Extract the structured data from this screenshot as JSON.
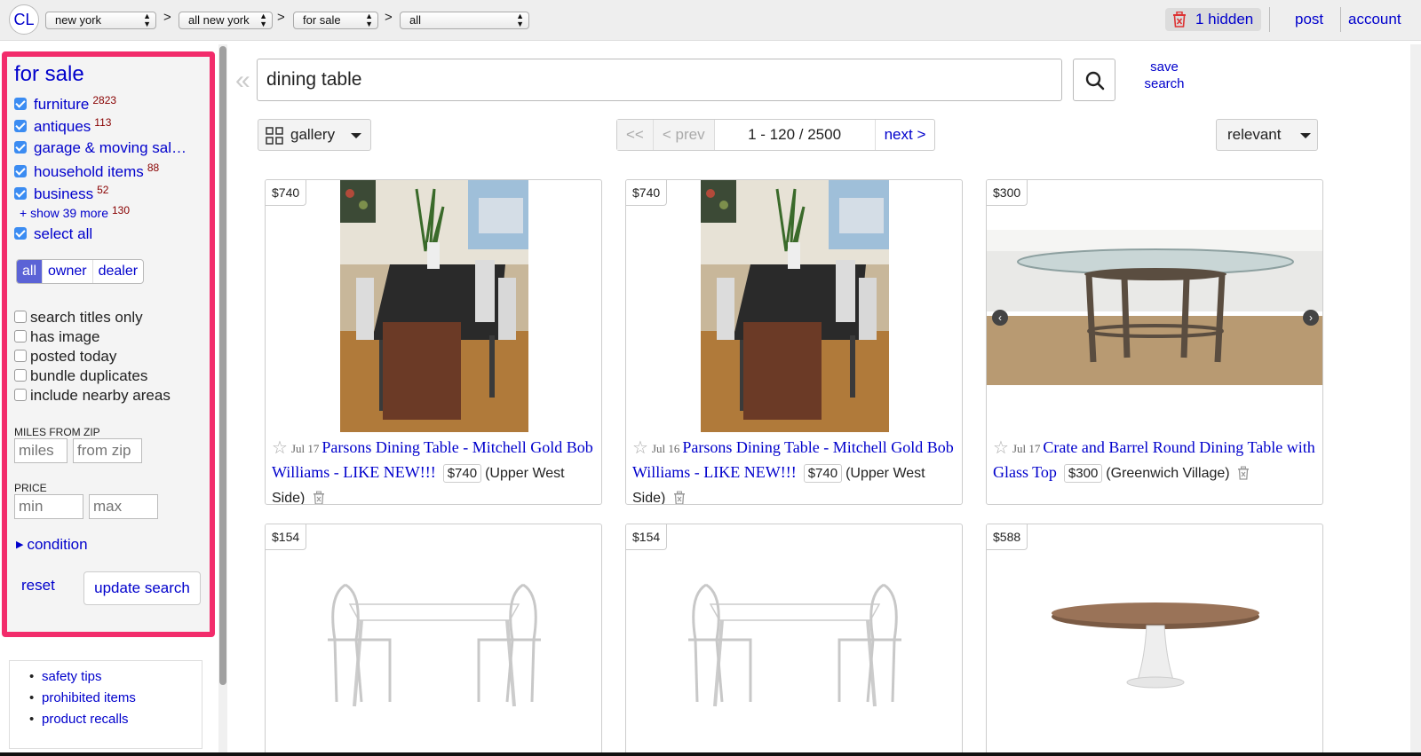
{
  "topbar": {
    "logo": "CL",
    "breadcrumbs": [
      {
        "value": "new york"
      },
      {
        "value": "all new york"
      },
      {
        "value": "for sale"
      },
      {
        "value": "all"
      }
    ],
    "separator": ">",
    "hidden_label": "1 hidden",
    "post_label": "post",
    "account_label": "account"
  },
  "sidebar": {
    "title": "for sale",
    "categories": [
      {
        "label": "furniture",
        "count": "2823",
        "checked": true
      },
      {
        "label": "antiques",
        "count": "113",
        "checked": true
      },
      {
        "label": "garage & moving sal…",
        "count": "",
        "checked": true
      },
      {
        "label": "household items",
        "count": "88",
        "checked": true
      },
      {
        "label": "business",
        "count": "52",
        "checked": true
      }
    ],
    "show_more": {
      "label": "+ show 39 more",
      "count": "130"
    },
    "select_all": "select all",
    "seller_filter": {
      "options": [
        "all",
        "owner",
        "dealer"
      ],
      "selected": "all"
    },
    "options": [
      {
        "label": "search titles only",
        "checked": false
      },
      {
        "label": "has image",
        "checked": false
      },
      {
        "label": "posted today",
        "checked": false
      },
      {
        "label": "bundle duplicates",
        "checked": false
      },
      {
        "label": "include nearby areas",
        "checked": false
      }
    ],
    "miles_caption": "MILES FROM ZIP",
    "miles_placeholder": "miles",
    "zip_placeholder": "from zip",
    "price_caption": "PRICE",
    "min_placeholder": "min",
    "max_placeholder": "max",
    "condition_label": "condition",
    "reset_label": "reset",
    "update_label": "update search",
    "footer_links": [
      "safety tips",
      "prohibited items",
      "product recalls"
    ]
  },
  "search": {
    "collapse": "«",
    "query": "dining table",
    "save_label_line1": "save",
    "save_label_line2": "search"
  },
  "toolbar": {
    "view_label": "gallery",
    "pager": {
      "first": "<<",
      "prev": "< prev",
      "range": "1 - 120 / 2500",
      "next": "next >"
    },
    "sort_label": "relevant"
  },
  "listings": [
    {
      "price": "$740",
      "date": "Jul 17",
      "title": "Parsons Dining Table - Mitchell Gold Bob Williams - LIKE NEW!!!",
      "hood": "(Upper West Side)",
      "image": "dining-room-photo"
    },
    {
      "price": "$740",
      "date": "Jul 16",
      "title": "Parsons Dining Table - Mitchell Gold Bob Williams - LIKE NEW!!!",
      "hood": "(Upper West Side)",
      "image": "dining-room-photo"
    },
    {
      "price": "$300",
      "date": "Jul 17",
      "title": "Crate and Barrel Round Dining Table with Glass Top",
      "hood": "(Greenwich Village)",
      "image": "glass-round-table-photo"
    },
    {
      "price": "$154",
      "image": "white-table-chairs-photo"
    },
    {
      "price": "$154",
      "image": "white-table-chairs-photo"
    },
    {
      "price": "$588",
      "image": "tulip-oval-table-photo"
    }
  ],
  "colors": {
    "link": "#0000cc",
    "highlight_border": "#f22c6b",
    "count": "#880000",
    "segment_active": "#5b63d6"
  }
}
